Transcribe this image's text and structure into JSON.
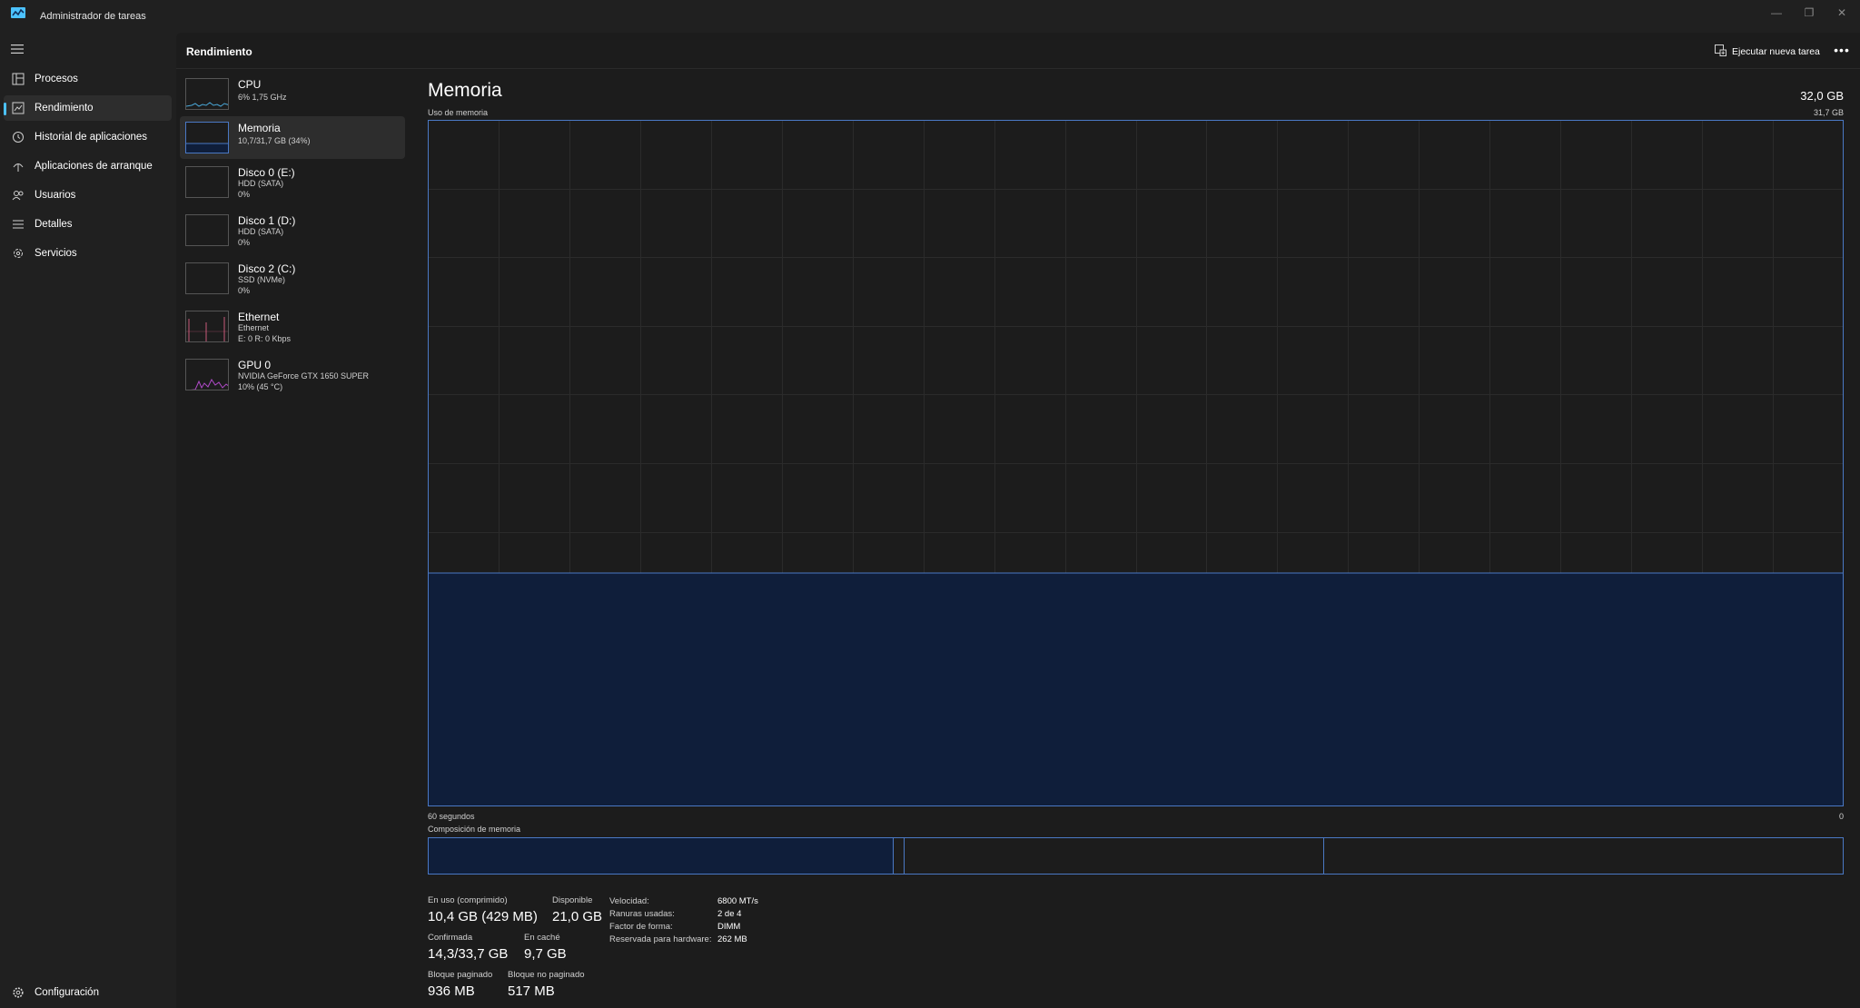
{
  "window": {
    "title": "Administrador de tareas",
    "controls": {
      "minimize": "—",
      "restore": "❐",
      "close": "✕"
    }
  },
  "nav": {
    "items": [
      {
        "label": "Procesos",
        "icon": "processes-icon"
      },
      {
        "label": "Rendimiento",
        "icon": "performance-icon",
        "active": true
      },
      {
        "label": "Historial de aplicaciones",
        "icon": "history-icon"
      },
      {
        "label": "Aplicaciones de arranque",
        "icon": "startup-icon"
      },
      {
        "label": "Usuarios",
        "icon": "users-icon"
      },
      {
        "label": "Detalles",
        "icon": "details-icon"
      },
      {
        "label": "Servicios",
        "icon": "services-icon"
      }
    ],
    "settings": {
      "label": "Configuración",
      "icon": "gear-icon"
    }
  },
  "header": {
    "title": "Rendimiento",
    "run_task": "Ejecutar nueva tarea",
    "more": "•••"
  },
  "resources": [
    {
      "name": "CPU",
      "sub1": "6% 1,75 GHz",
      "sub2": ""
    },
    {
      "name": "Memoria",
      "sub1": "10,7/31,7 GB (34%)",
      "sub2": "",
      "active": true
    },
    {
      "name": "Disco 0 (E:)",
      "sub1": "HDD (SATA)",
      "sub2": "0%"
    },
    {
      "name": "Disco 1 (D:)",
      "sub1": "HDD (SATA)",
      "sub2": "0%"
    },
    {
      "name": "Disco 2 (C:)",
      "sub1": "SSD (NVMe)",
      "sub2": "0%"
    },
    {
      "name": "Ethernet",
      "sub1": "Ethernet",
      "sub2": "E: 0 R: 0 Kbps"
    },
    {
      "name": "GPU 0",
      "sub1": "NVIDIA GeForce GTX 1650 SUPER",
      "sub2": "10% (45 °C)"
    }
  ],
  "detail": {
    "title": "Memoria",
    "total": "32,0 GB",
    "usage_label": "Uso de memoria",
    "usage_max": "31,7 GB",
    "axis_left": "60 segundos",
    "axis_right": "0",
    "usage_fraction": 0.34,
    "composition_label": "Composición de memoria",
    "composition": {
      "in_use_fraction": 0.329,
      "modified_fraction": 0.008,
      "standby_fraction": 0.297,
      "free_fraction": 0.366
    },
    "stats": {
      "in_use_label": "En uso (comprimido)",
      "in_use_value": "10,4 GB (429 MB)",
      "available_label": "Disponible",
      "available_value": "21,0 GB",
      "committed_label": "Confirmada",
      "committed_value": "14,3/33,7 GB",
      "cached_label": "En caché",
      "cached_value": "9,7 GB",
      "paged_label": "Bloque paginado",
      "paged_value": "936 MB",
      "nonpaged_label": "Bloque no paginado",
      "nonpaged_value": "517 MB"
    },
    "props": [
      {
        "k": "Velocidad:",
        "v": "6800 MT/s"
      },
      {
        "k": "Ranuras usadas:",
        "v": "2 de 4"
      },
      {
        "k": "Factor de forma:",
        "v": "DIMM"
      },
      {
        "k": "Reservada para hardware:",
        "v": "262 MB"
      }
    ]
  },
  "colors": {
    "accent": "#4cc2ff",
    "memory_line": "#4a78c4",
    "memory_fill": "#0f1e3a",
    "cpu_line": "#4aa8d8",
    "ethernet_line": "#c85a7a",
    "gpu_line": "#b04ac8"
  }
}
